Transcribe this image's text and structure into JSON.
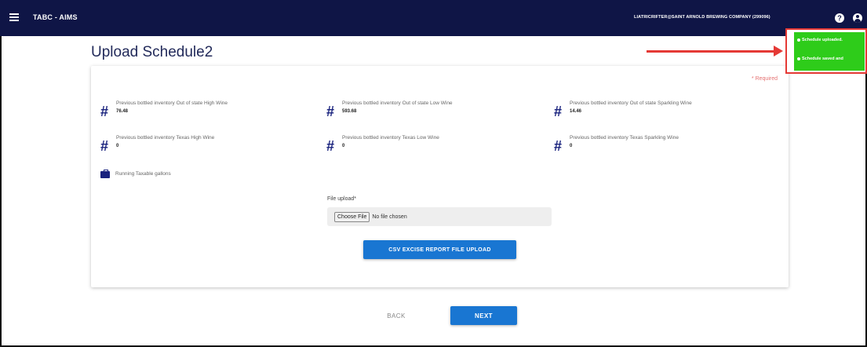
{
  "header": {
    "app_title": "TABC - AIMS",
    "user_text": "LIATRICRIFTER@SAINT ARNOLD BREWING COMPANY (299096)",
    "help_icon": "?"
  },
  "page": {
    "title": "Upload Schedule2",
    "required_note": "* Required"
  },
  "fields": [
    {
      "label": "Previous bottled inventory Out of state High Wine",
      "value": "76.48"
    },
    {
      "label": "Previous bottled inventory Out of state Low Wine",
      "value": "593.68"
    },
    {
      "label": "Previous bottled inventory Out of state Sparkling Wine",
      "value": "14.46"
    },
    {
      "label": "Previous bottled inventory Texas High Wine",
      "value": "0"
    },
    {
      "label": "Previous bottled inventory Texas Low Wine",
      "value": "0"
    },
    {
      "label": "Previous bottled inventory Texas Sparkling Wine",
      "value": "0"
    }
  ],
  "running": {
    "label": "Running Taxable gallons"
  },
  "upload": {
    "label": "File upload*",
    "choose_label": "Choose File",
    "no_file_text": "No file chosen",
    "csv_button": "CSV EXCISE REPORT FILE UPLOAD"
  },
  "nav": {
    "back": "BACK",
    "next": "NEXT"
  },
  "toasts": [
    {
      "text": "Schedule uploaded."
    },
    {
      "text": "Schedule saved and"
    }
  ],
  "colors": {
    "header_bg": "#0f1546",
    "primary": "#1976d2",
    "toast_green": "#2ecc1a",
    "annotation_red": "#e53935"
  }
}
